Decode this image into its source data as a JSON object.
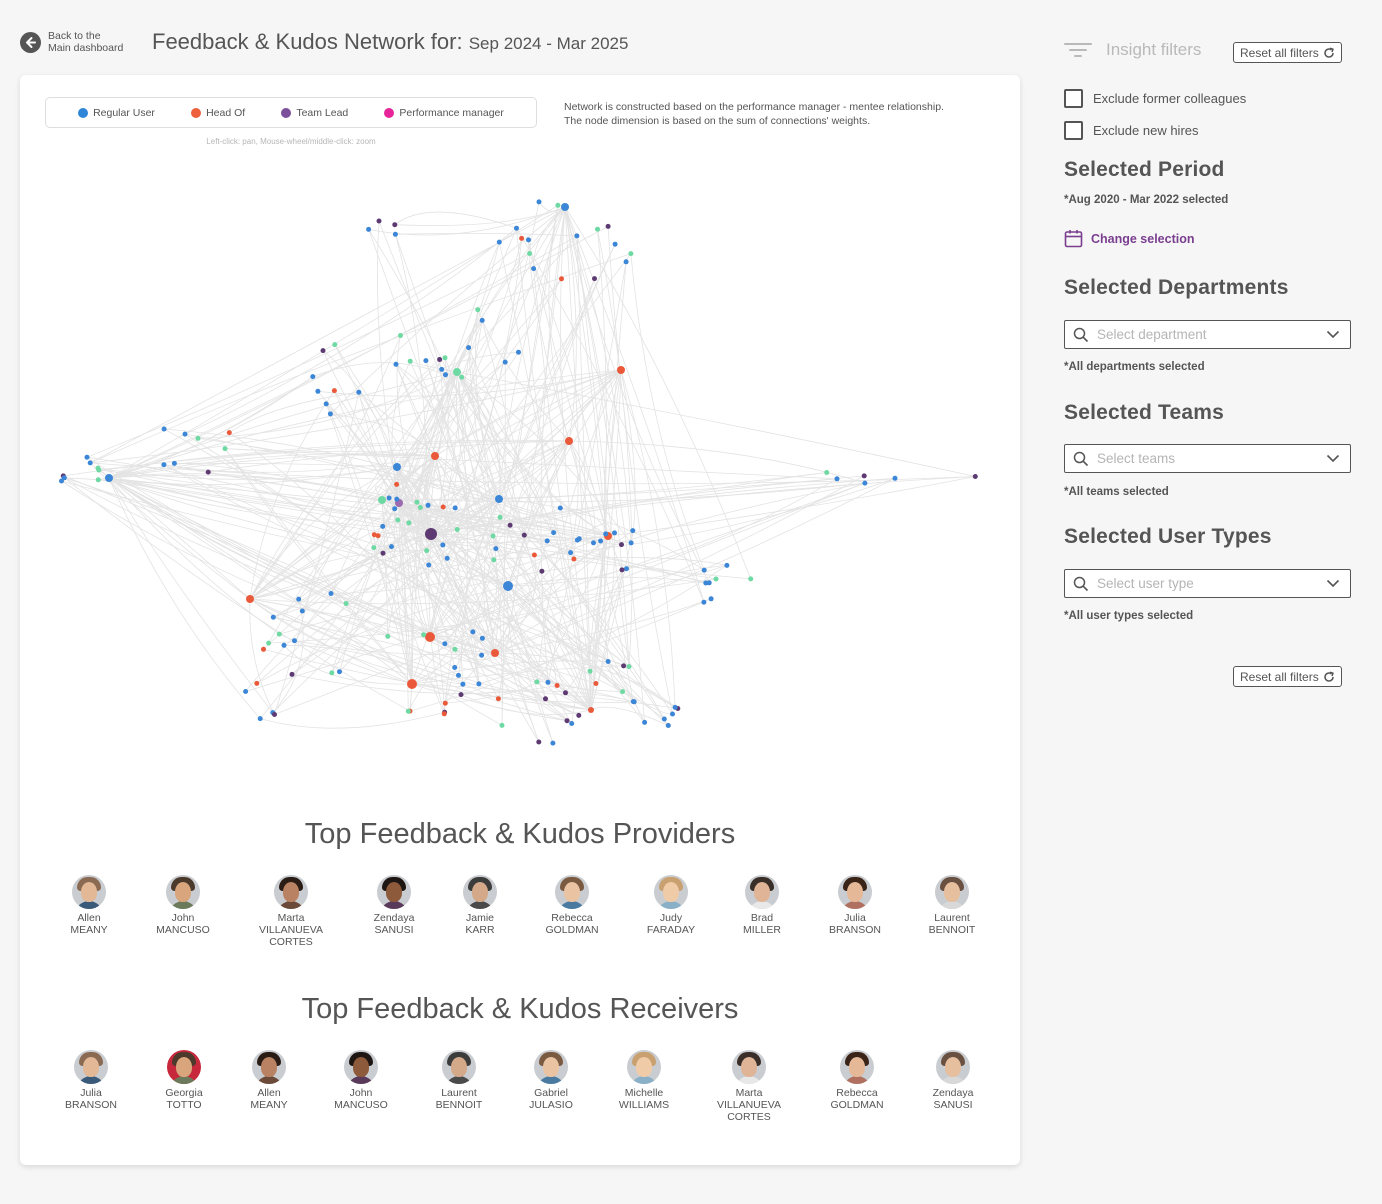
{
  "header": {
    "back_line1": "Back to the",
    "back_line2": "Main dashboard",
    "title": "Feedback & Kudos Network for:",
    "period": "Sep 2024 - Mar 2025"
  },
  "legend": {
    "items": [
      {
        "label": "Regular User",
        "color": "#2f86d8"
      },
      {
        "label": "Head Of",
        "color": "#ee5f3c"
      },
      {
        "label": "Team Lead",
        "color": "#7b4f99"
      },
      {
        "label": "Performance manager",
        "color": "#e6259a"
      }
    ],
    "hint": "Left-click: pan, Mouse-wheel/middle-click: zoom"
  },
  "description": {
    "line1": "Network is constructed based on the performance manager - mentee relationship.",
    "line2": "The node dimension is based on the sum of connections' weights."
  },
  "network_colors": {
    "regular": "#3b86d6",
    "head": "#ea5a3a",
    "lead": "#5e3a73",
    "mentor": "#6fd9a3",
    "purple_node": "#9b6bb0",
    "edge": "#e3e3e3"
  },
  "providers": {
    "title": "Top Feedback & Kudos Providers",
    "people": [
      {
        "first": "Allen",
        "last": "MEANY",
        "last2": ""
      },
      {
        "first": "John",
        "last": "MANCUSO",
        "last2": ""
      },
      {
        "first": "Marta",
        "last": "VILLANUEVA",
        "last2": "CORTES"
      },
      {
        "first": "Zendaya",
        "last": "SANUSI",
        "last2": ""
      },
      {
        "first": "Jamie",
        "last": "KARR",
        "last2": ""
      },
      {
        "first": "Rebecca",
        "last": "GOLDMAN",
        "last2": ""
      },
      {
        "first": "Judy",
        "last": "FARADAY",
        "last2": ""
      },
      {
        "first": "Brad",
        "last": "MILLER",
        "last2": ""
      },
      {
        "first": "Julia",
        "last": "BRANSON",
        "last2": ""
      },
      {
        "first": "Laurent",
        "last": "BENNOIT",
        "last2": ""
      }
    ]
  },
  "receivers": {
    "title": "Top Feedback & Kudos Receivers",
    "people": [
      {
        "first": "Julia",
        "last": "BRANSON",
        "last2": ""
      },
      {
        "first": "Georgia",
        "last": "TOTTO",
        "last2": ""
      },
      {
        "first": "Allen",
        "last": "MEANY",
        "last2": ""
      },
      {
        "first": "John",
        "last": "MANCUSO",
        "last2": ""
      },
      {
        "first": "Laurent",
        "last": "BENNOIT",
        "last2": ""
      },
      {
        "first": "Gabriel",
        "last": "JULASIO",
        "last2": ""
      },
      {
        "first": "Michelle",
        "last": "WILLIAMS",
        "last2": ""
      },
      {
        "first": "Marta",
        "last": "VILLANUEVA",
        "last2": "CORTES"
      },
      {
        "first": "Rebecca",
        "last": "GOLDMAN",
        "last2": ""
      },
      {
        "first": "Zendaya",
        "last": "SANUSI",
        "last2": ""
      }
    ]
  },
  "sidebar": {
    "filters_title": "Insight filters",
    "reset_label": "Reset all filters",
    "exclude_former": "Exclude former colleagues",
    "exclude_new": "Exclude new hires",
    "period_title": "Selected Period",
    "period_note": "*Aug 2020 - Mar 2022 selected",
    "change_selection": "Change selection",
    "departments_title": "Selected Departments",
    "departments_placeholder": "Select department",
    "departments_note": "*All departments selected",
    "teams_title": "Selected Teams",
    "teams_placeholder": "Select teams",
    "teams_note": "*All teams selected",
    "usertypes_title": "Selected User Types",
    "usertypes_placeholder": "Select user type",
    "usertypes_note": "*All user types selected",
    "accent_color": "#7a3e8e"
  }
}
